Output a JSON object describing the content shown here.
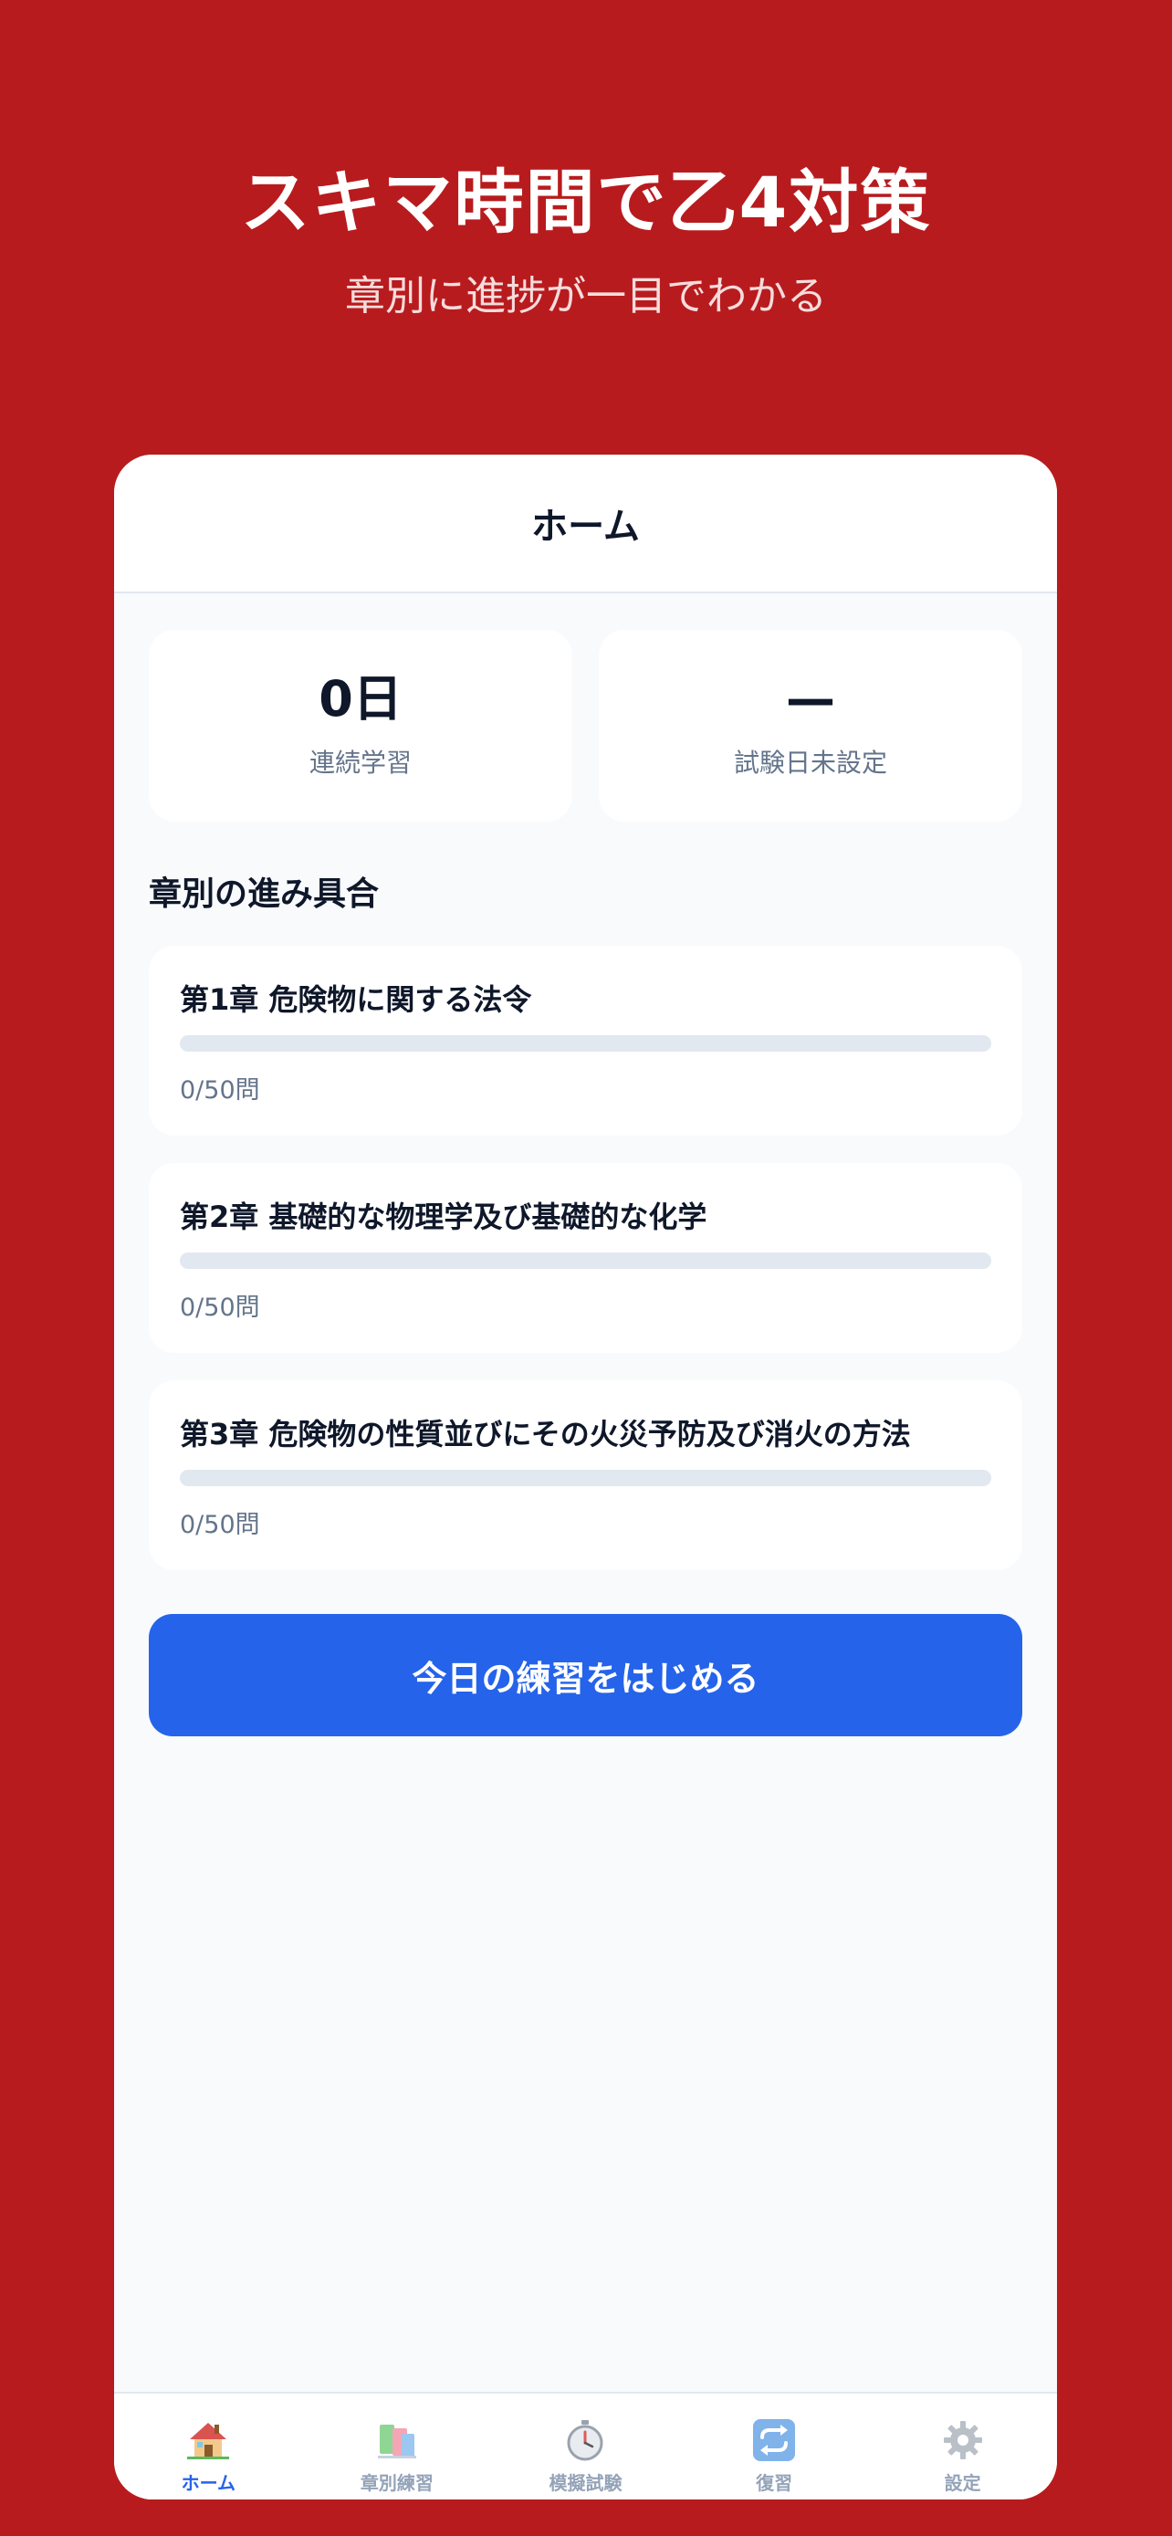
{
  "hero": {
    "title": "スキマ時間で乙4対策",
    "subtitle": "章別に進捗が一目でわかる"
  },
  "header": {
    "title": "ホーム"
  },
  "stats": [
    {
      "value": "0日",
      "label": "連続学習"
    },
    {
      "value": "—",
      "label": "試験日未設定"
    }
  ],
  "section": {
    "title": "章別の進み具合"
  },
  "chapters": [
    {
      "title": "第1章 危険物に関する法令",
      "count": "0/50問",
      "progress": 0
    },
    {
      "title": "第2章 基礎的な物理学及び基礎的な化学",
      "count": "0/50問",
      "progress": 0
    },
    {
      "title": "第3章 危険物の性質並びにその火災予防及び消火の方法",
      "count": "0/50問",
      "progress": 0
    }
  ],
  "cta": {
    "label": "今日の練習をはじめる"
  },
  "tabs": [
    {
      "label": "ホーム",
      "icon": "house-icon",
      "active": true
    },
    {
      "label": "章別練習",
      "icon": "books-icon",
      "active": false
    },
    {
      "label": "模擬試験",
      "icon": "stopwatch-icon",
      "active": false
    },
    {
      "label": "復習",
      "icon": "repeat-icon",
      "active": false
    },
    {
      "label": "設定",
      "icon": "gear-icon",
      "active": false
    }
  ],
  "colors": {
    "background": "#b81b1e",
    "accent": "#2563eb",
    "track": "#e2e8f0"
  }
}
